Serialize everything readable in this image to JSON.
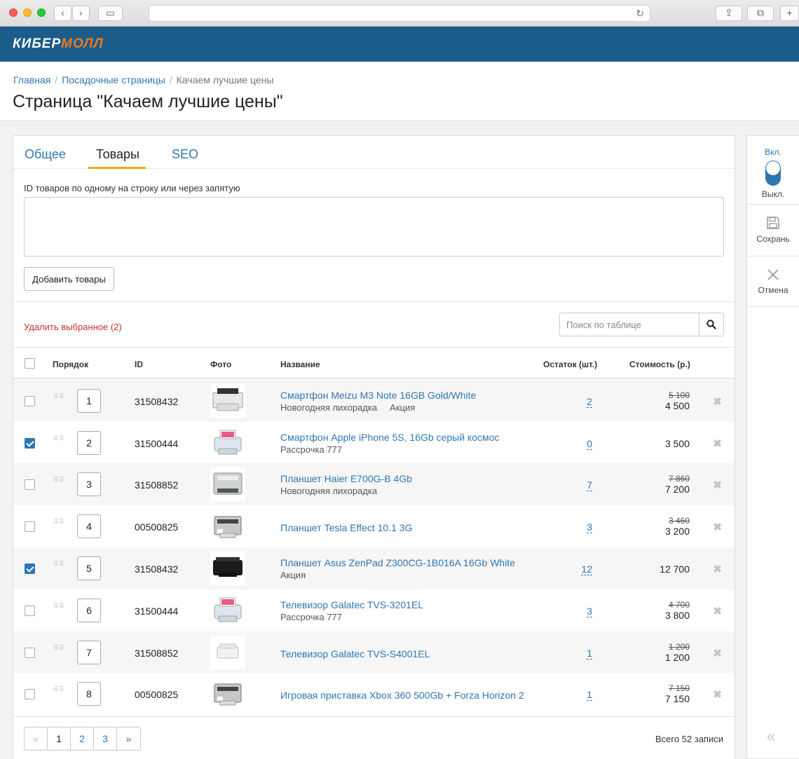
{
  "brand": {
    "logo_part1": "КИБЕР",
    "logo_part2": "МОЛЛ",
    "header_color": "#1c5c89",
    "accent_color": "#f07a1a"
  },
  "breadcrumb": [
    "Главная",
    "Посадочные страницы",
    "Качаем лучшие цены"
  ],
  "page_title": "Страница \"Качаем лучшие цены\"",
  "tabs": [
    "Общее",
    "Товары",
    "SEO"
  ],
  "active_tab": "Товары",
  "ids_field": {
    "label": "ID товаров по одному на строку или через запятую",
    "value": ""
  },
  "add_button": "Добавить товары",
  "delete_selected": "Удалить выбранное (2)",
  "search": {
    "placeholder": "Поиск по таблице"
  },
  "table": {
    "headers": {
      "order": "Порядок",
      "id": "ID",
      "photo": "Фото",
      "name": "Название",
      "stock": "Остаток (шт.)",
      "price": "Стоимость (р.)"
    },
    "rows": [
      {
        "checked": false,
        "order": "1",
        "id": "31508432",
        "photo": "printer-white-icon",
        "name": "Смартфон Meizu M3 Note 16GB Gold/White",
        "tags": [
          "Новогодняя лихорадка",
          "Акция"
        ],
        "stock": "2",
        "old_price": "5 100",
        "price": "4 500"
      },
      {
        "checked": true,
        "order": "2",
        "id": "31500444",
        "photo": "photo-printer-icon",
        "name": "Смартфон Apple iPhone 5S, 16Gb серый космос",
        "tags": [
          "Рассрочка 777"
        ],
        "stock": "0",
        "old_price": "",
        "price": "3 500"
      },
      {
        "checked": false,
        "order": "3",
        "id": "31508852",
        "photo": "laser-printer-gray-icon",
        "name": "Планшет Haier E700G-B 4Gb",
        "tags": [
          "Новогодняя лихорадка"
        ],
        "stock": "7",
        "old_price": "7 860",
        "price": "7 200"
      },
      {
        "checked": false,
        "order": "4",
        "id": "00500825",
        "photo": "printer-gray-icon",
        "name": "Планшет Tesla Effect 10.1 3G",
        "tags": [],
        "stock": "3",
        "old_price": "3 460",
        "price": "3 200"
      },
      {
        "checked": true,
        "order": "5",
        "id": "31508432",
        "photo": "printer-black-icon",
        "name": "Планшет Asus ZenPad Z300CG-1B016A 16Gb White",
        "tags": [
          "Акция"
        ],
        "stock": "12",
        "old_price": "",
        "price": "12 700"
      },
      {
        "checked": false,
        "order": "6",
        "id": "31500444",
        "photo": "photo-printer-icon",
        "name": "Телевизор Galatec TVS-3201EL",
        "tags": [
          "Рассрочка 777"
        ],
        "stock": "3",
        "old_price": "4 700",
        "price": "3 800"
      },
      {
        "checked": false,
        "order": "7",
        "id": "31508852",
        "photo": "printer-small-white-icon",
        "name": "Телевизор Galatec TVS-S4001EL",
        "tags": [],
        "stock": "1",
        "old_price": "1 200",
        "price": "1 200"
      },
      {
        "checked": false,
        "order": "8",
        "id": "00500825",
        "photo": "printer-gray-icon",
        "name": "Игровая приставка Xbox 360 500Gb + Forza Horizon 2",
        "tags": [],
        "stock": "1",
        "old_price": "7 150",
        "price": "7 150"
      }
    ]
  },
  "pagination": {
    "prev": "«",
    "pages": [
      "1",
      "2",
      "3"
    ],
    "current": "1",
    "next": "»",
    "total": "Всего 52 записи"
  },
  "sidebar": {
    "on_label": "Вкл.",
    "off_label": "Выкл.",
    "save_label": "Сохрань",
    "cancel_label": "Отмена",
    "collapse_glyph": "«"
  }
}
